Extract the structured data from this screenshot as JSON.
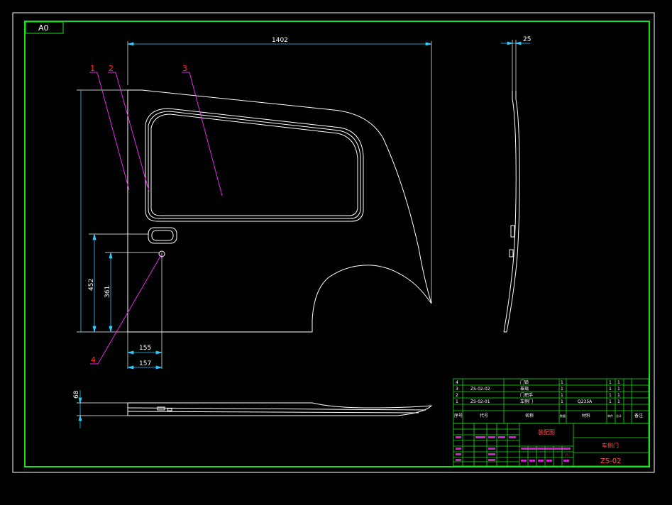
{
  "sheet": {
    "size_label": "A0"
  },
  "dimensions": {
    "overall_width": "1402",
    "thickness": "25",
    "height_452": "452",
    "height_361": "361",
    "offset_155": "155",
    "offset_157": "157",
    "bottom_68": "68"
  },
  "balloons": [
    "1",
    "2",
    "3",
    "4"
  ],
  "parts_list": {
    "rows": [
      {
        "no": "4",
        "code": "",
        "name": "门锁",
        "qty": "1",
        "material": "",
        "w1": "1",
        "w2": "1",
        "note": ""
      },
      {
        "no": "3",
        "code": "ZS-02-02",
        "name": "玻璃",
        "qty": "1",
        "material": "",
        "w1": "1",
        "w2": "1",
        "note": ""
      },
      {
        "no": "2",
        "code": "",
        "name": "门把手",
        "qty": "1",
        "material": "",
        "w1": "1",
        "w2": "1",
        "note": ""
      },
      {
        "no": "1",
        "code": "ZS-02-01",
        "name": "车侧门",
        "qty": "1",
        "material": "Q235A",
        "w1": "1",
        "w2": "1",
        "note": ""
      }
    ],
    "header": {
      "no": "序号",
      "code": "代号",
      "name": "名称",
      "qty": "数量",
      "material": "材料",
      "w1": "单件",
      "w2": "总计",
      "note": "备注"
    }
  },
  "title_block": {
    "drawing_name": "装配图",
    "part_name": "车侧门",
    "drawing_no": "ZS-02",
    "scale_number": "15"
  },
  "colors": {
    "frame": "#18e018",
    "geometry": "#ffffff",
    "dimension": "#30c8ff",
    "leader": "#ff2aff",
    "balloon_text": "#ff2a2a",
    "title_grid": "#18e018",
    "title_cells": "#ff2aff"
  }
}
